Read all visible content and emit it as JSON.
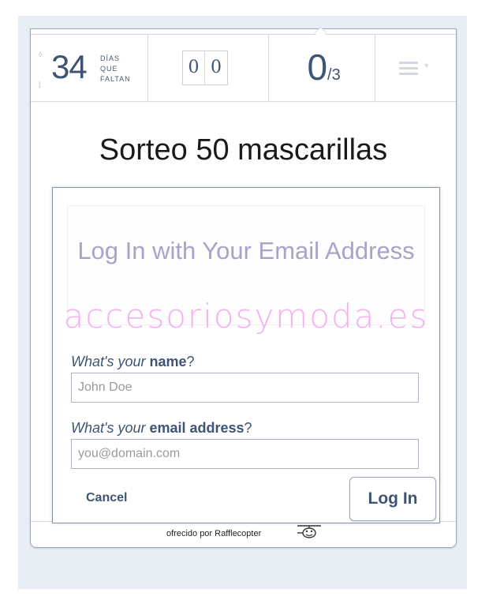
{
  "stats": {
    "days_number": "34",
    "days_label_lines": [
      "DÍAS",
      "QUE",
      "FALTAN"
    ],
    "counter_digits": [
      "0",
      "0"
    ],
    "entries_current": "0",
    "entries_total": "/3",
    "menu_icon": "hamburger-menu-icon"
  },
  "page": {
    "title": "Sorteo 50 mascarillas"
  },
  "login_modal": {
    "title": "Log In with Your Email Address",
    "watermark": "accesoriosymoda.es",
    "name_label": {
      "prefix": "What's your ",
      "strong": "name",
      "suffix": "?"
    },
    "name_placeholder": "John Doe",
    "email_label": {
      "prefix": "What's your ",
      "strong": "email address",
      "suffix": "?"
    },
    "email_placeholder": "you@domain.com",
    "cancel_label": "Cancel",
    "login_label": "Log In"
  },
  "footer": {
    "powered_by": "ofrecido por Rafflecopter",
    "logo_icon": "rafflecopter-logo-icon"
  },
  "colors": {
    "accent": "#3e5474",
    "modal_title": "#a9a3c9",
    "watermark": "#f4a3ee"
  }
}
